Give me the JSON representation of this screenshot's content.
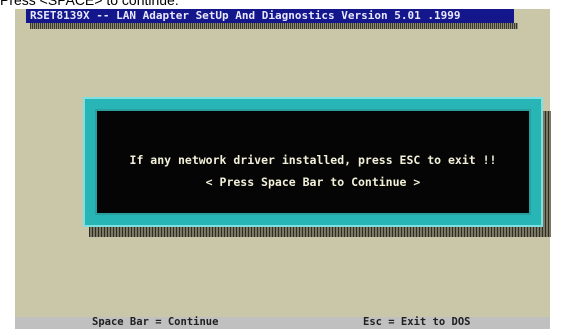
{
  "caption": "Press <SPACE> to continue.",
  "window": {
    "title": "RSET8139X -- LAN Adapter SetUp And Diagnostics Version 5.01 .1999"
  },
  "dialog": {
    "message": "If any network driver installed, press ESC to exit !!",
    "prompt": "< Press Space Bar to Continue >"
  },
  "statusbar": {
    "left_hint": "Space Bar = Continue",
    "right_hint": "Esc = Exit to DOS"
  },
  "colors": {
    "screen_background": "#c9c7a8",
    "title_background": "#14168c",
    "dialog_frame": "#27b5b6",
    "dialog_background": "#050505"
  }
}
